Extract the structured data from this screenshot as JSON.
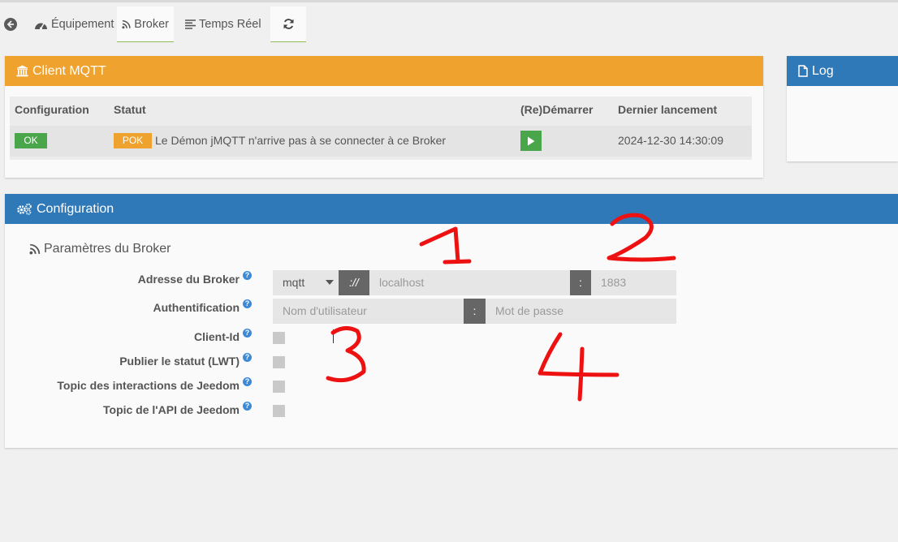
{
  "tabs": {
    "equipement": "Équipement",
    "broker": "Broker",
    "temps_reel": "Temps Réel"
  },
  "client_panel": {
    "title": "Client MQTT",
    "headers": {
      "configuration": "Configuration",
      "statut": "Statut",
      "redemarrer": "(Re)Démarrer",
      "dernier": "Dernier lancement"
    },
    "row": {
      "config_badge": "OK",
      "status_badge": "POK",
      "status_text": "Le Démon jMQTT n'arrive pas à se connecter à ce Broker",
      "last_launch": "2024-12-30 14:30:09"
    }
  },
  "log_panel": {
    "title": "Log"
  },
  "config_panel": {
    "title": "Configuration",
    "section_title": "Paramètres du Broker",
    "fields": {
      "adresse_label": "Adresse du Broker",
      "protocol_value": "mqtt",
      "scheme_sep": "://",
      "host_placeholder": "localhost",
      "port_sep": ":",
      "port_placeholder": "1883",
      "auth_label": "Authentification",
      "user_placeholder": "Nom d'utilisateur",
      "auth_sep": ":",
      "pass_placeholder": "Mot de passe",
      "client_id_label": "Client-Id",
      "lwt_label": "Publier le statut (LWT)",
      "interactions_label": "Topic des interactions de Jeedom",
      "api_label": "Topic de l'API de Jeedom"
    }
  },
  "annotations": [
    "1",
    "2",
    "3",
    "4"
  ],
  "colors": {
    "orange": "#f0a22e",
    "blue": "#3079b8",
    "green": "#4aa64a",
    "annotation_red": "#ee1111"
  }
}
